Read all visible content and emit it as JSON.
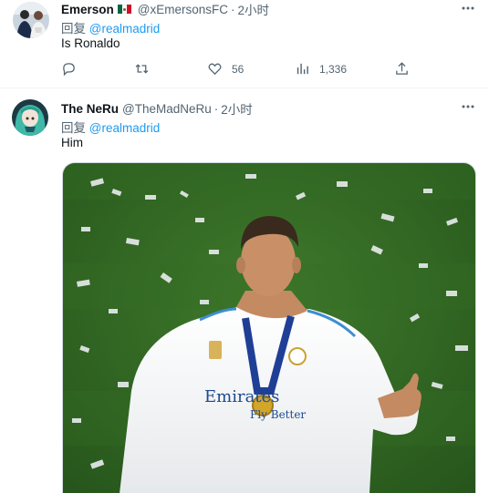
{
  "tweets": [
    {
      "name": "Emerson",
      "flag_icon": "mexico-flag-icon",
      "handle": "@xEmersonsFC",
      "separator": "·",
      "time": "2小时",
      "reply_prefix": "回复 ",
      "reply_to": "@realmadrid",
      "text": "Is Ronaldo",
      "actions": {
        "reply_count": "",
        "retweet_count": "",
        "like_count": "56",
        "view_count": "1,336"
      }
    },
    {
      "name": "The NeRu",
      "handle": "@TheMadNeRu",
      "separator": "·",
      "time": "2小时",
      "reply_prefix": "回复 ",
      "reply_to": "@realmadrid",
      "text": "Him",
      "media": {
        "type": "photo",
        "jersey_text": "Emirates",
        "jersey_text_2": "Fly Better"
      }
    }
  ],
  "colors": {
    "accent": "#1d9bf0",
    "secondary_text": "#536471",
    "primary_text": "#0f1419",
    "border": "#eff3f4"
  }
}
